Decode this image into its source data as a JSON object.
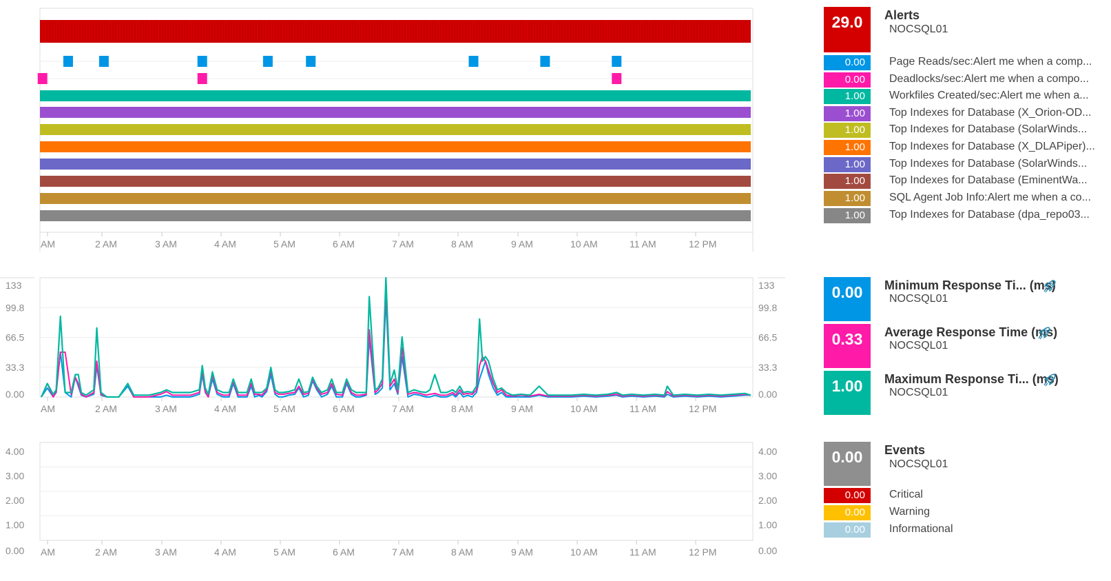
{
  "chart_data": [
    {
      "type": "timeline",
      "x_ticks": [
        "AM",
        "2 AM",
        "3 AM",
        "4 AM",
        "5 AM",
        "6 AM",
        "7 AM",
        "8 AM",
        "9 AM",
        "10 AM",
        "11 AM",
        "12 PM"
      ],
      "x_range_hours": [
        1.1,
        13.0
      ],
      "series": [
        {
          "name": "Alerts",
          "color": "#d40000",
          "full": true
        },
        {
          "name": "Page Reads/sec:Alert me when a comp...",
          "color": "#0096e6",
          "events": [
            1.55,
            2.15,
            3.8,
            4.9,
            5.62,
            8.35,
            9.55,
            10.75
          ]
        },
        {
          "name": "Deadlocks/sec:Alert me when a compo...",
          "color": "#ff1aa8",
          "events": [
            1.12,
            3.8,
            10.75
          ]
        },
        {
          "name": "Workfiles Created/sec:Alert me when a...",
          "color": "#00b8a0",
          "full": true
        },
        {
          "name": "Top Indexes for Database (X_Orion-OD...",
          "color": "#9b4fd0",
          "full": true
        },
        {
          "name": "Top Indexes for Database (SolarWinds...",
          "color": "#c0bd22",
          "full": true
        },
        {
          "name": "Top Indexes for Database (X_DLAPiper)...",
          "color": "#ff7300",
          "full": true
        },
        {
          "name": "Top Indexes for Database (SolarWinds...",
          "color": "#6b68c8",
          "full": true
        },
        {
          "name": "Top Indexes for Database (EminentWa...",
          "color": "#a34a40",
          "full": true
        },
        {
          "name": "SQL Agent Job Info:Alert me when a co...",
          "color": "#c08e30",
          "full": true
        },
        {
          "name": "Top Indexes for Database (dpa_repo03...",
          "color": "#878787",
          "full": true
        }
      ]
    },
    {
      "type": "line",
      "x_ticks": [
        "AM",
        "2 AM",
        "3 AM",
        "4 AM",
        "5 AM",
        "6 AM",
        "7 AM",
        "8 AM",
        "9 AM",
        "10 AM",
        "11 AM",
        "12 PM"
      ],
      "x_range_hours": [
        1.1,
        13.0
      ],
      "y_ticks": [
        "133",
        "99.8",
        "66.5",
        "33.3",
        "0.00"
      ],
      "ylim": [
        0,
        133
      ],
      "x_hours": [
        1.1,
        1.2,
        1.3,
        1.35,
        1.42,
        1.5,
        1.6,
        1.67,
        1.72,
        1.77,
        1.85,
        1.98,
        2.03,
        2.1,
        2.2,
        2.3,
        2.4,
        2.55,
        2.65,
        2.75,
        2.9,
        3.1,
        3.2,
        3.3,
        3.4,
        3.6,
        3.75,
        3.8,
        3.85,
        3.9,
        3.97,
        4.05,
        4.15,
        4.25,
        4.32,
        4.4,
        4.48,
        4.55,
        4.62,
        4.68,
        4.75,
        4.8,
        4.88,
        4.95,
        5.02,
        5.08,
        5.15,
        5.25,
        5.35,
        5.42,
        5.5,
        5.58,
        5.65,
        5.72,
        5.8,
        5.9,
        5.97,
        6.05,
        6.15,
        6.22,
        6.3,
        6.38,
        6.45,
        6.55,
        6.6,
        6.7,
        6.75,
        6.82,
        6.88,
        6.95,
        7.02,
        7.08,
        7.15,
        7.25,
        7.35,
        7.45,
        7.55,
        7.62,
        7.7,
        7.8,
        7.9,
        8.0,
        8.05,
        8.12,
        8.18,
        8.25,
        8.33,
        8.4,
        8.45,
        8.5,
        8.55,
        8.6,
        8.68,
        8.75,
        8.82,
        8.9,
        9.0,
        9.15,
        9.3,
        9.45,
        9.6,
        9.8,
        10.0,
        10.2,
        10.4,
        10.6,
        10.75,
        10.85,
        11.0,
        11.2,
        11.4,
        11.55,
        11.6,
        11.7,
        11.9,
        12.1,
        12.3,
        12.5,
        12.7,
        12.9,
        13.0
      ],
      "series": [
        {
          "name": "Minimum Response Ti... (ms)",
          "color": "#0096e6",
          "values": [
            0,
            10,
            0,
            5,
            50,
            5,
            0,
            22,
            12,
            2,
            0,
            3,
            35,
            2,
            0,
            0,
            0,
            12,
            0,
            0,
            0,
            0,
            2,
            0,
            0,
            0,
            3,
            25,
            5,
            0,
            20,
            3,
            0,
            0,
            15,
            0,
            0,
            0,
            12,
            0,
            2,
            0,
            6,
            25,
            3,
            0,
            0,
            2,
            3,
            10,
            0,
            2,
            18,
            8,
            0,
            3,
            12,
            0,
            0,
            15,
            3,
            0,
            0,
            2,
            65,
            3,
            5,
            10,
            110,
            8,
            15,
            3,
            45,
            0,
            3,
            2,
            0,
            0,
            2,
            0,
            0,
            3,
            0,
            5,
            0,
            2,
            0,
            5,
            20,
            30,
            40,
            25,
            10,
            2,
            5,
            0,
            0,
            0,
            0,
            2,
            0,
            0,
            0,
            1,
            0,
            1,
            2,
            0,
            1,
            0,
            1,
            0,
            3,
            0,
            1,
            0,
            1,
            0,
            1,
            2,
            2
          ]
        },
        {
          "name": "Average Response Time (ms)",
          "color": "#ff1aa8",
          "values": [
            0,
            15,
            0,
            6,
            50,
            50,
            3,
            22,
            15,
            3,
            0,
            5,
            40,
            3,
            0,
            0,
            0,
            15,
            0,
            0,
            0,
            3,
            6,
            2,
            2,
            2,
            5,
            30,
            6,
            0,
            25,
            5,
            2,
            2,
            18,
            2,
            2,
            2,
            15,
            3,
            3,
            2,
            8,
            30,
            5,
            3,
            3,
            4,
            5,
            12,
            3,
            4,
            20,
            10,
            3,
            5,
            15,
            3,
            2,
            18,
            5,
            2,
            2,
            3,
            75,
            5,
            8,
            15,
            120,
            12,
            20,
            5,
            55,
            3,
            5,
            4,
            2,
            3,
            4,
            2,
            2,
            5,
            2,
            8,
            3,
            4,
            3,
            8,
            35,
            45,
            40,
            30,
            15,
            5,
            8,
            2,
            1,
            2,
            1,
            3,
            1,
            1,
            1,
            2,
            1,
            2,
            3,
            1,
            2,
            1,
            2,
            1,
            6,
            1,
            2,
            1,
            2,
            1,
            2,
            3,
            2
          ]
        },
        {
          "name": "Maximum Response Ti... (ms)",
          "color": "#00b8a0",
          "values": [
            0,
            15,
            3,
            8,
            90,
            5,
            5,
            25,
            25,
            5,
            2,
            8,
            77,
            5,
            0,
            0,
            0,
            15,
            2,
            2,
            2,
            5,
            8,
            5,
            5,
            5,
            8,
            35,
            10,
            3,
            28,
            8,
            5,
            5,
            20,
            5,
            5,
            5,
            20,
            5,
            5,
            5,
            10,
            33,
            8,
            5,
            5,
            6,
            8,
            20,
            5,
            6,
            22,
            12,
            5,
            8,
            20,
            5,
            5,
            20,
            8,
            5,
            5,
            5,
            112,
            8,
            10,
            20,
            133,
            15,
            30,
            8,
            67,
            5,
            8,
            6,
            5,
            8,
            25,
            5,
            5,
            8,
            5,
            12,
            5,
            6,
            5,
            12,
            87,
            40,
            45,
            40,
            20,
            8,
            10,
            5,
            2,
            3,
            2,
            12,
            2,
            2,
            2,
            3,
            2,
            3,
            5,
            2,
            3,
            2,
            3,
            2,
            12,
            2,
            3,
            2,
            3,
            2,
            3,
            4,
            2
          ]
        }
      ]
    },
    {
      "type": "bar",
      "x_ticks": [
        "AM",
        "2 AM",
        "3 AM",
        "4 AM",
        "5 AM",
        "6 AM",
        "7 AM",
        "8 AM",
        "9 AM",
        "10 AM",
        "11 AM",
        "12 PM"
      ],
      "y_ticks": [
        "4.00",
        "3.00",
        "2.00",
        "1.00",
        "0.00"
      ],
      "ylim": [
        0,
        4
      ],
      "series": [
        {
          "name": "Critical",
          "values": []
        },
        {
          "name": "Warning",
          "values": []
        },
        {
          "name": "Informational",
          "values": []
        }
      ]
    }
  ],
  "alerts_legend": {
    "total": {
      "value": "29.0",
      "title": "Alerts",
      "subtitle": "NOCSQL01",
      "color": "#d40000"
    },
    "items": [
      {
        "value": "0.00",
        "label": "Page Reads/sec:Alert me when a comp...",
        "color": "#0096e6"
      },
      {
        "value": "0.00",
        "label": "Deadlocks/sec:Alert me when a compo...",
        "color": "#ff1aa8"
      },
      {
        "value": "1.00",
        "label": "Workfiles Created/sec:Alert me when a...",
        "color": "#00b8a0"
      },
      {
        "value": "1.00",
        "label": "Top Indexes for Database (X_Orion-OD...",
        "color": "#9b4fd0"
      },
      {
        "value": "1.00",
        "label": "Top Indexes for Database (SolarWinds...",
        "color": "#c0bd22"
      },
      {
        "value": "1.00",
        "label": "Top Indexes for Database (X_DLAPiper)...",
        "color": "#ff7300"
      },
      {
        "value": "1.00",
        "label": "Top Indexes for Database (SolarWinds...",
        "color": "#6b68c8"
      },
      {
        "value": "1.00",
        "label": "Top Indexes for Database (EminentWa...",
        "color": "#a34a40"
      },
      {
        "value": "1.00",
        "label": "SQL Agent Job Info:Alert me when a co...",
        "color": "#c08e30"
      },
      {
        "value": "1.00",
        "label": "Top Indexes for Database (dpa_repo03...",
        "color": "#878787"
      }
    ]
  },
  "response_legend": [
    {
      "value": "0.00",
      "title": "Minimum Response Ti...  (ms)",
      "subtitle": "NOCSQL01",
      "color": "#0096e6",
      "icon": "rocket-icon"
    },
    {
      "value": "0.33",
      "title": "Average Response Time (ms)",
      "subtitle": "NOCSQL01",
      "color": "#ff1aa8",
      "icon": "rocket-icon"
    },
    {
      "value": "1.00",
      "title": "Maximum Response Ti...  (ms)",
      "subtitle": "NOCSQL01",
      "color": "#00b8a0",
      "icon": "rocket-icon"
    }
  ],
  "events_legend": {
    "total": {
      "value": "0.00",
      "title": "Events",
      "subtitle": "NOCSQL01",
      "color": "#8f8f8f"
    },
    "items": [
      {
        "value": "0.00",
        "label": "Critical",
        "color": "#d40000"
      },
      {
        "value": "0.00",
        "label": "Warning",
        "color": "#ffc000"
      },
      {
        "value": "0.00",
        "label": "Informational",
        "color": "#a7cfe0"
      }
    ]
  }
}
